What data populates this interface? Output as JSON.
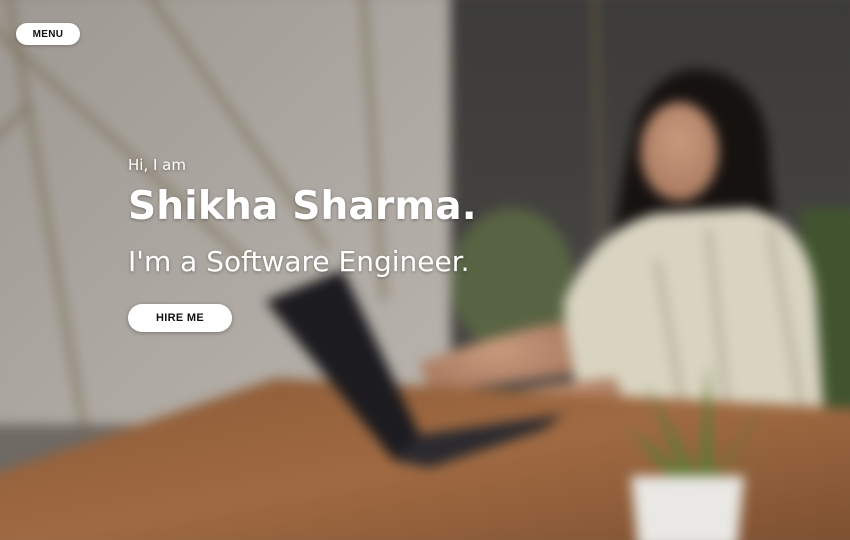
{
  "nav": {
    "menu_label": "MENU"
  },
  "hero": {
    "greeting": "Hi, I am",
    "name": "Shikha Sharma.",
    "role": "I'm a Software Engineer.",
    "cta_label": "HIRE ME",
    "background_image": "blurred photo of a woman typing on a laptop at a wooden desk with a potted plant"
  },
  "colors": {
    "text": "#ffffff",
    "button_bg": "#ffffff",
    "button_text": "#111111"
  }
}
